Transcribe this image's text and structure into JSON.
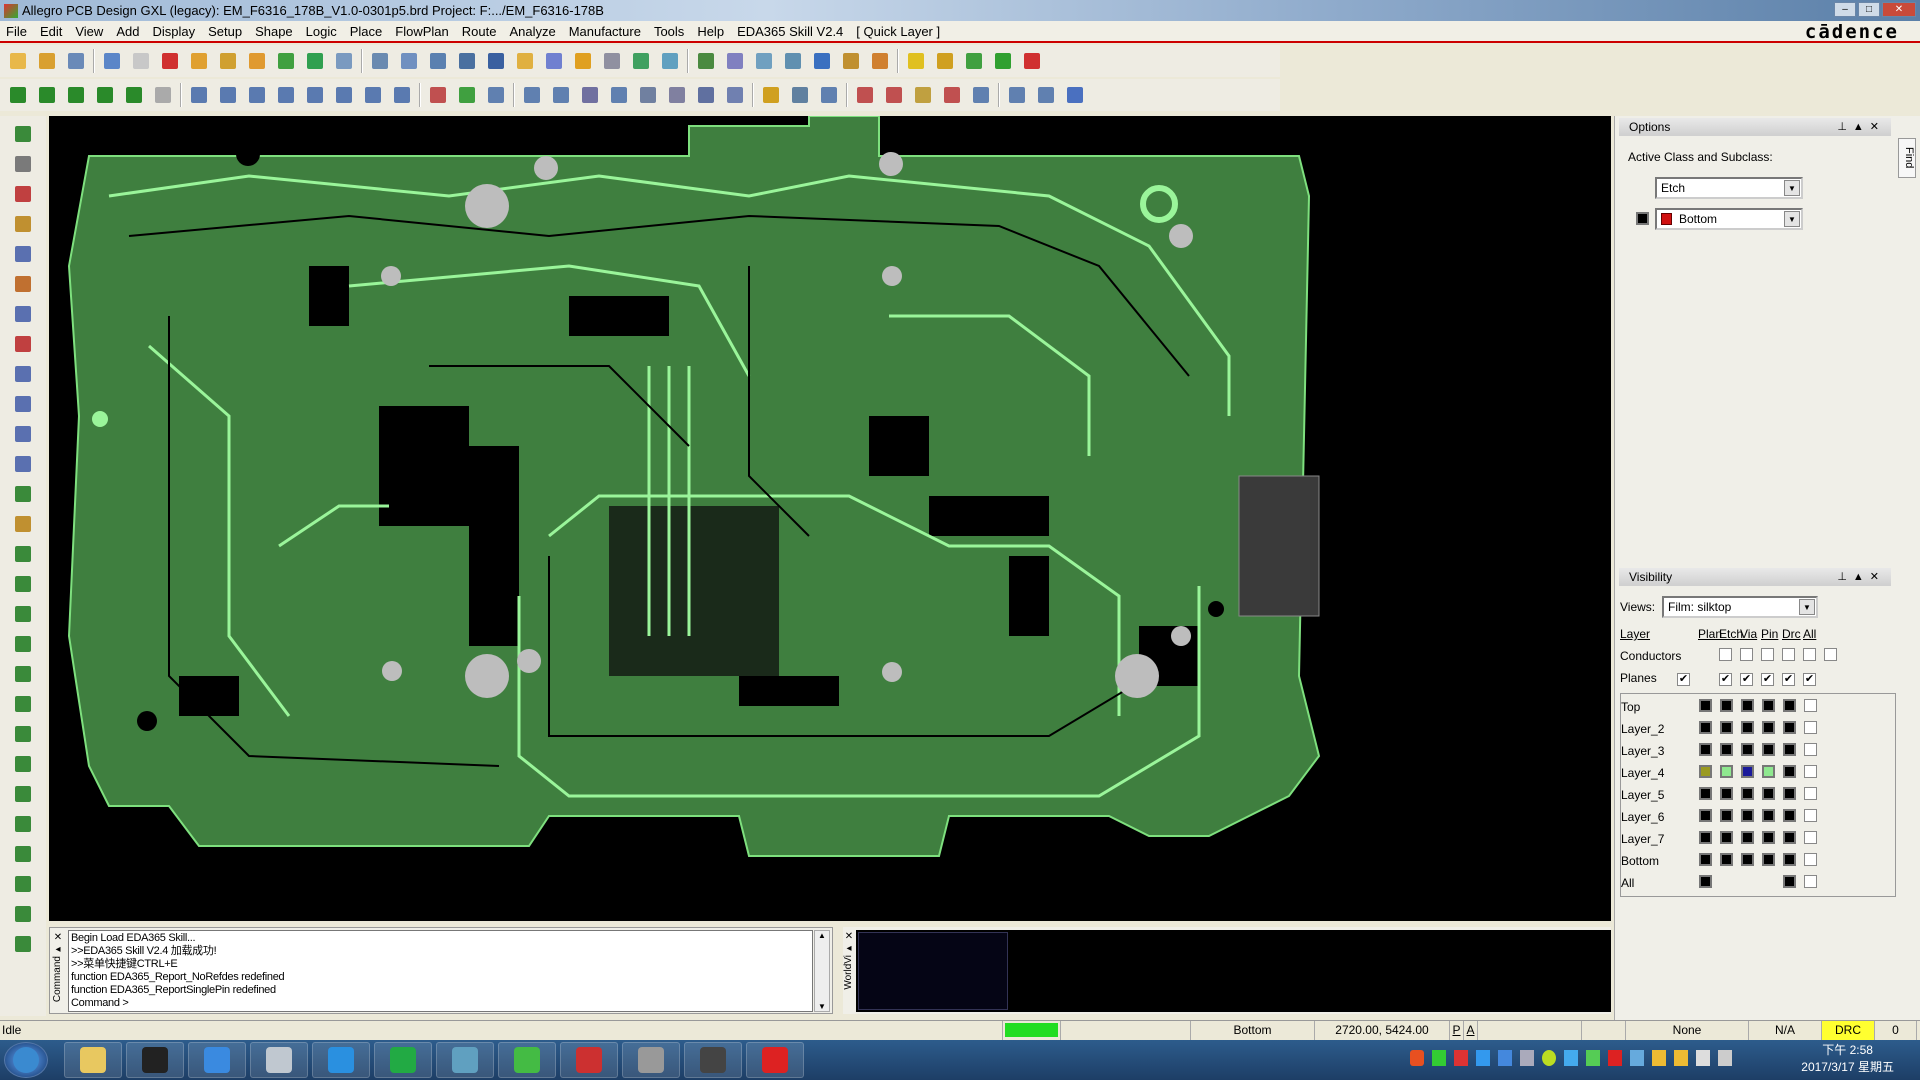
{
  "window": {
    "title": "Allegro PCB Design GXL (legacy): EM_F6316_178B_V1.0-0301p5.brd  Project: F:.../EM_F6316-178B",
    "controls": [
      "–",
      "□",
      "✕"
    ]
  },
  "menu": {
    "items": [
      "File",
      "Edit",
      "View",
      "Add",
      "Display",
      "Setup",
      "Shape",
      "Logic",
      "Place",
      "FlowPlan",
      "Route",
      "Analyze",
      "Manufacture",
      "Tools",
      "Help",
      "EDA365 Skill V2.4",
      "[ Quick Layer ]"
    ],
    "brand": "cādence"
  },
  "toolbar_colors": [
    "#e8b84a",
    "#d9a030",
    "#6a8ab8",
    "#5b86c8",
    "#c8c8c8",
    "#d03030",
    "#e0a030",
    "#d0a030",
    "#e09a30",
    "#40a040",
    "#30a050",
    "#7a9ac0",
    "#6a8ab0",
    "#7090c0",
    "#5a80b0",
    "#4a70a0",
    "#3a60a0",
    "#e0b040",
    "#7080d0",
    "#e0a020",
    "#9090a0",
    "#40a060",
    "#60a0c0",
    "#4a8a40",
    "#8080c0",
    "#70a0c0",
    "#6090b0",
    "#3a70c0",
    "#c09030",
    "#d08030",
    "#e0c020",
    "#d0a020",
    "#40a040",
    "#30a030",
    "#d03030"
  ],
  "toolbar2_colors": [
    "#2a8a2a",
    "#2a8a2a",
    "#2a8a2a",
    "#2a8a2a",
    "#2a8a2a",
    "#aaaaaa",
    "#5a7ab0",
    "#5a7ab0",
    "#5a7ab0",
    "#5a7ab0",
    "#5a7ab0",
    "#5a7ab0",
    "#5a7ab0",
    "#5a7ab0",
    "#c05050",
    "#40a040",
    "#6080b0",
    "#6080b0",
    "#6080b0",
    "#7070a0",
    "#6080b0",
    "#7080a0",
    "#8080a0",
    "#6070a0",
    "#7080b0",
    "#d0a020",
    "#6080a0",
    "#6080b0",
    "#c05050",
    "#c05050",
    "#c0a040",
    "#c05050",
    "#6080b0",
    "#6080b0",
    "#6080b0",
    "#4a70c0"
  ],
  "left_tool_colors": [
    "#3a8a3a",
    "#7a7a7a",
    "#c04040",
    "#c09030",
    "#5a70b0",
    "#c07030",
    "#5a70b0",
    "#c04040",
    "#5a70b0",
    "#5a70b0",
    "#5a70b0",
    "#5a70b0",
    "#3a8a3a",
    "#c09030",
    "#3a8a3a",
    "#3a8a3a",
    "#3a8a3a",
    "#3a8a3a",
    "#3a8a3a",
    "#3a8a3a",
    "#3a8a3a",
    "#3a8a3a",
    "#3a8a3a",
    "#3a8a3a",
    "#3a8a3a",
    "#3a8a3a",
    "#3a8a3a",
    "#3a8a3a"
  ],
  "options": {
    "title": "Options",
    "label": "Active Class and Subclass:",
    "class_value": "Etch",
    "subclass_value": "Bottom",
    "subclass_color": "#d01010",
    "find_tab": "Find"
  },
  "visibility": {
    "title": "Visibility",
    "views_label": "Views:",
    "views_value": "Film: silktop",
    "columns": [
      "Layer",
      "Plan",
      "Etch",
      "Via",
      "Pin",
      "Drc",
      "All"
    ],
    "conductors_label": "Conductors",
    "planes_label": "Planes",
    "conductors": [
      false,
      false,
      false,
      false,
      false,
      false
    ],
    "planes": [
      true,
      null,
      true,
      true,
      true,
      true,
      true
    ],
    "layers": [
      {
        "name": "Top",
        "colors": [
          "#000000",
          "#000000",
          "#000000",
          "#000000",
          "#000000"
        ]
      },
      {
        "name": "Layer_2",
        "colors": [
          "#000000",
          "#000000",
          "#000000",
          "#000000",
          "#000000"
        ]
      },
      {
        "name": "Layer_3",
        "colors": [
          "#000000",
          "#000000",
          "#000000",
          "#000000",
          "#000000"
        ]
      },
      {
        "name": "Layer_4",
        "colors": [
          "#9a9a20",
          "#8fe88f",
          "#1a1a9a",
          "#8fe88f",
          "#000000"
        ]
      },
      {
        "name": "Layer_5",
        "colors": [
          "#000000",
          "#000000",
          "#000000",
          "#000000",
          "#000000"
        ]
      },
      {
        "name": "Layer_6",
        "colors": [
          "#000000",
          "#000000",
          "#000000",
          "#000000",
          "#000000"
        ]
      },
      {
        "name": "Layer_7",
        "colors": [
          "#000000",
          "#000000",
          "#000000",
          "#000000",
          "#000000"
        ]
      },
      {
        "name": "Bottom",
        "colors": [
          "#000000",
          "#000000",
          "#000000",
          "#000000",
          "#000000"
        ]
      },
      {
        "name": "All",
        "colors": [
          "#000000",
          null,
          null,
          null,
          "#000000"
        ]
      }
    ]
  },
  "command": {
    "tab": "Command",
    "lines": [
      "Begin Load EDA365 Skill...",
      ">>EDA365 Skill V2.4 加载成功!",
      ">>菜单快捷键CTRL+E",
      "function EDA365_Report_NoRefdes redefined",
      "function EDA365_ReportSinglePin redefined",
      "Command >"
    ]
  },
  "worldview": {
    "tab": "WorldVi"
  },
  "status": {
    "state": "Idle",
    "layer": "Bottom",
    "coords": "2720.00, 5424.00",
    "p": "P",
    "a": "A",
    "mode": "None",
    "na": "N/A",
    "drc": "DRC",
    "drc_count": "0",
    "ready_color": "#22dd22",
    "drc_color": "#ffff30"
  },
  "taskbar": {
    "apps": [
      "start",
      "file-explorer",
      "qq",
      "baidu-cloud",
      "calculator",
      "browser",
      "wps",
      "pcb-tool",
      "wechat",
      "allegro",
      "image-viewer",
      "font-app",
      "mail"
    ],
    "app_colors": [
      "#3a8ad0",
      "#e8c860",
      "#222222",
      "#3a8ae0",
      "#c0c8d0",
      "#2a90e0",
      "#22aa44",
      "#60a0c0",
      "#44bb44",
      "#cc3030",
      "#999999",
      "#444444",
      "#dd2222"
    ],
    "time": "下午 2:58",
    "date": "2017/3/17 星期五"
  }
}
